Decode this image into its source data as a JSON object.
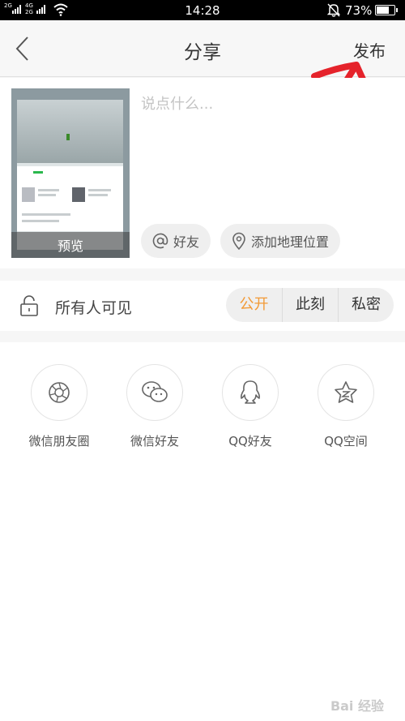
{
  "status_bar": {
    "signal_1": "2G",
    "signal_2": "4G",
    "signal_3": "2G",
    "signal_4": "2G",
    "time": "14:28",
    "battery": "73%",
    "battery_level": 0.73
  },
  "header": {
    "title": "分享",
    "publish_label": "发布"
  },
  "compose": {
    "placeholder": "说点什么...",
    "preview_label": "预览",
    "friends_label": "好友",
    "location_label": "添加地理位置"
  },
  "visibility": {
    "label": "所有人可见",
    "options": [
      "公开",
      "此刻",
      "私密"
    ],
    "selected": "公开"
  },
  "share_targets": [
    {
      "label": "微信朋友圈",
      "icon": "moments-icon"
    },
    {
      "label": "微信好友",
      "icon": "wechat-icon"
    },
    {
      "label": "QQ好友",
      "icon": "qq-icon"
    },
    {
      "label": "QQ空间",
      "icon": "qzone-icon"
    }
  ],
  "watermark": "Bai 经验",
  "colors": {
    "accent": "#f29a36",
    "annotation": "#e5232b"
  }
}
